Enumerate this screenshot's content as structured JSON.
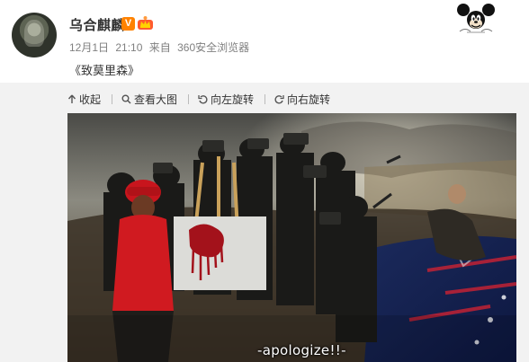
{
  "post": {
    "username": "乌合麒麟",
    "verified_badge": "V",
    "date": "12月1日",
    "time": "21:10",
    "source_prefix": "来自",
    "source": "360安全浏览器",
    "text": "《致莫里森》"
  },
  "toolbar": {
    "collapse_label": "收起",
    "view_large_label": "查看大图",
    "rotate_left_label": "向左旋转",
    "rotate_right_label": "向右旋转"
  },
  "image": {
    "subtitle": "-apologize!!-"
  },
  "icons": [
    "verified-v-icon",
    "member-crown-icon",
    "mickey-mouse-icon",
    "up-arrow-icon",
    "search-icon",
    "rotate-left-icon",
    "rotate-right-icon"
  ],
  "colors": {
    "accent_orange": "#ff8200",
    "toolbar_bg": "#f2f2f2",
    "meta_gray": "#808080"
  }
}
